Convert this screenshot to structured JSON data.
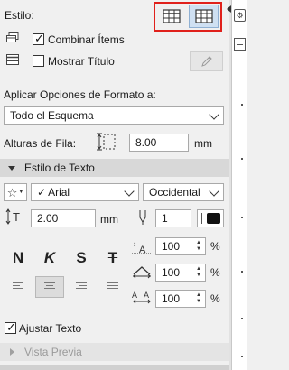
{
  "style": {
    "label": "Estilo:"
  },
  "options": {
    "combine_items": {
      "label": "Combinar Ítems",
      "checked": true
    },
    "show_title": {
      "label": "Mostrar Título",
      "checked": false
    }
  },
  "apply_format": {
    "label": "Aplicar Opciones de Formato a:",
    "selected": "Todo el Esquema"
  },
  "row_height": {
    "label": "Alturas de Fila:",
    "value": "8.00",
    "unit": "mm"
  },
  "text_style": {
    "header": "Estilo de Texto",
    "font": "Arial",
    "script": "Occidental",
    "size": {
      "value": "2.00",
      "unit": "mm"
    },
    "pen": "1",
    "format_buttons": [
      "N",
      "K",
      "S",
      "T"
    ],
    "width_factor": "100",
    "spacing": "100",
    "char_spacing": "100",
    "percent": "%"
  },
  "wrap_text": {
    "label": "Ajustar Texto",
    "checked": true
  },
  "preview": {
    "header": "Vista Previa"
  }
}
